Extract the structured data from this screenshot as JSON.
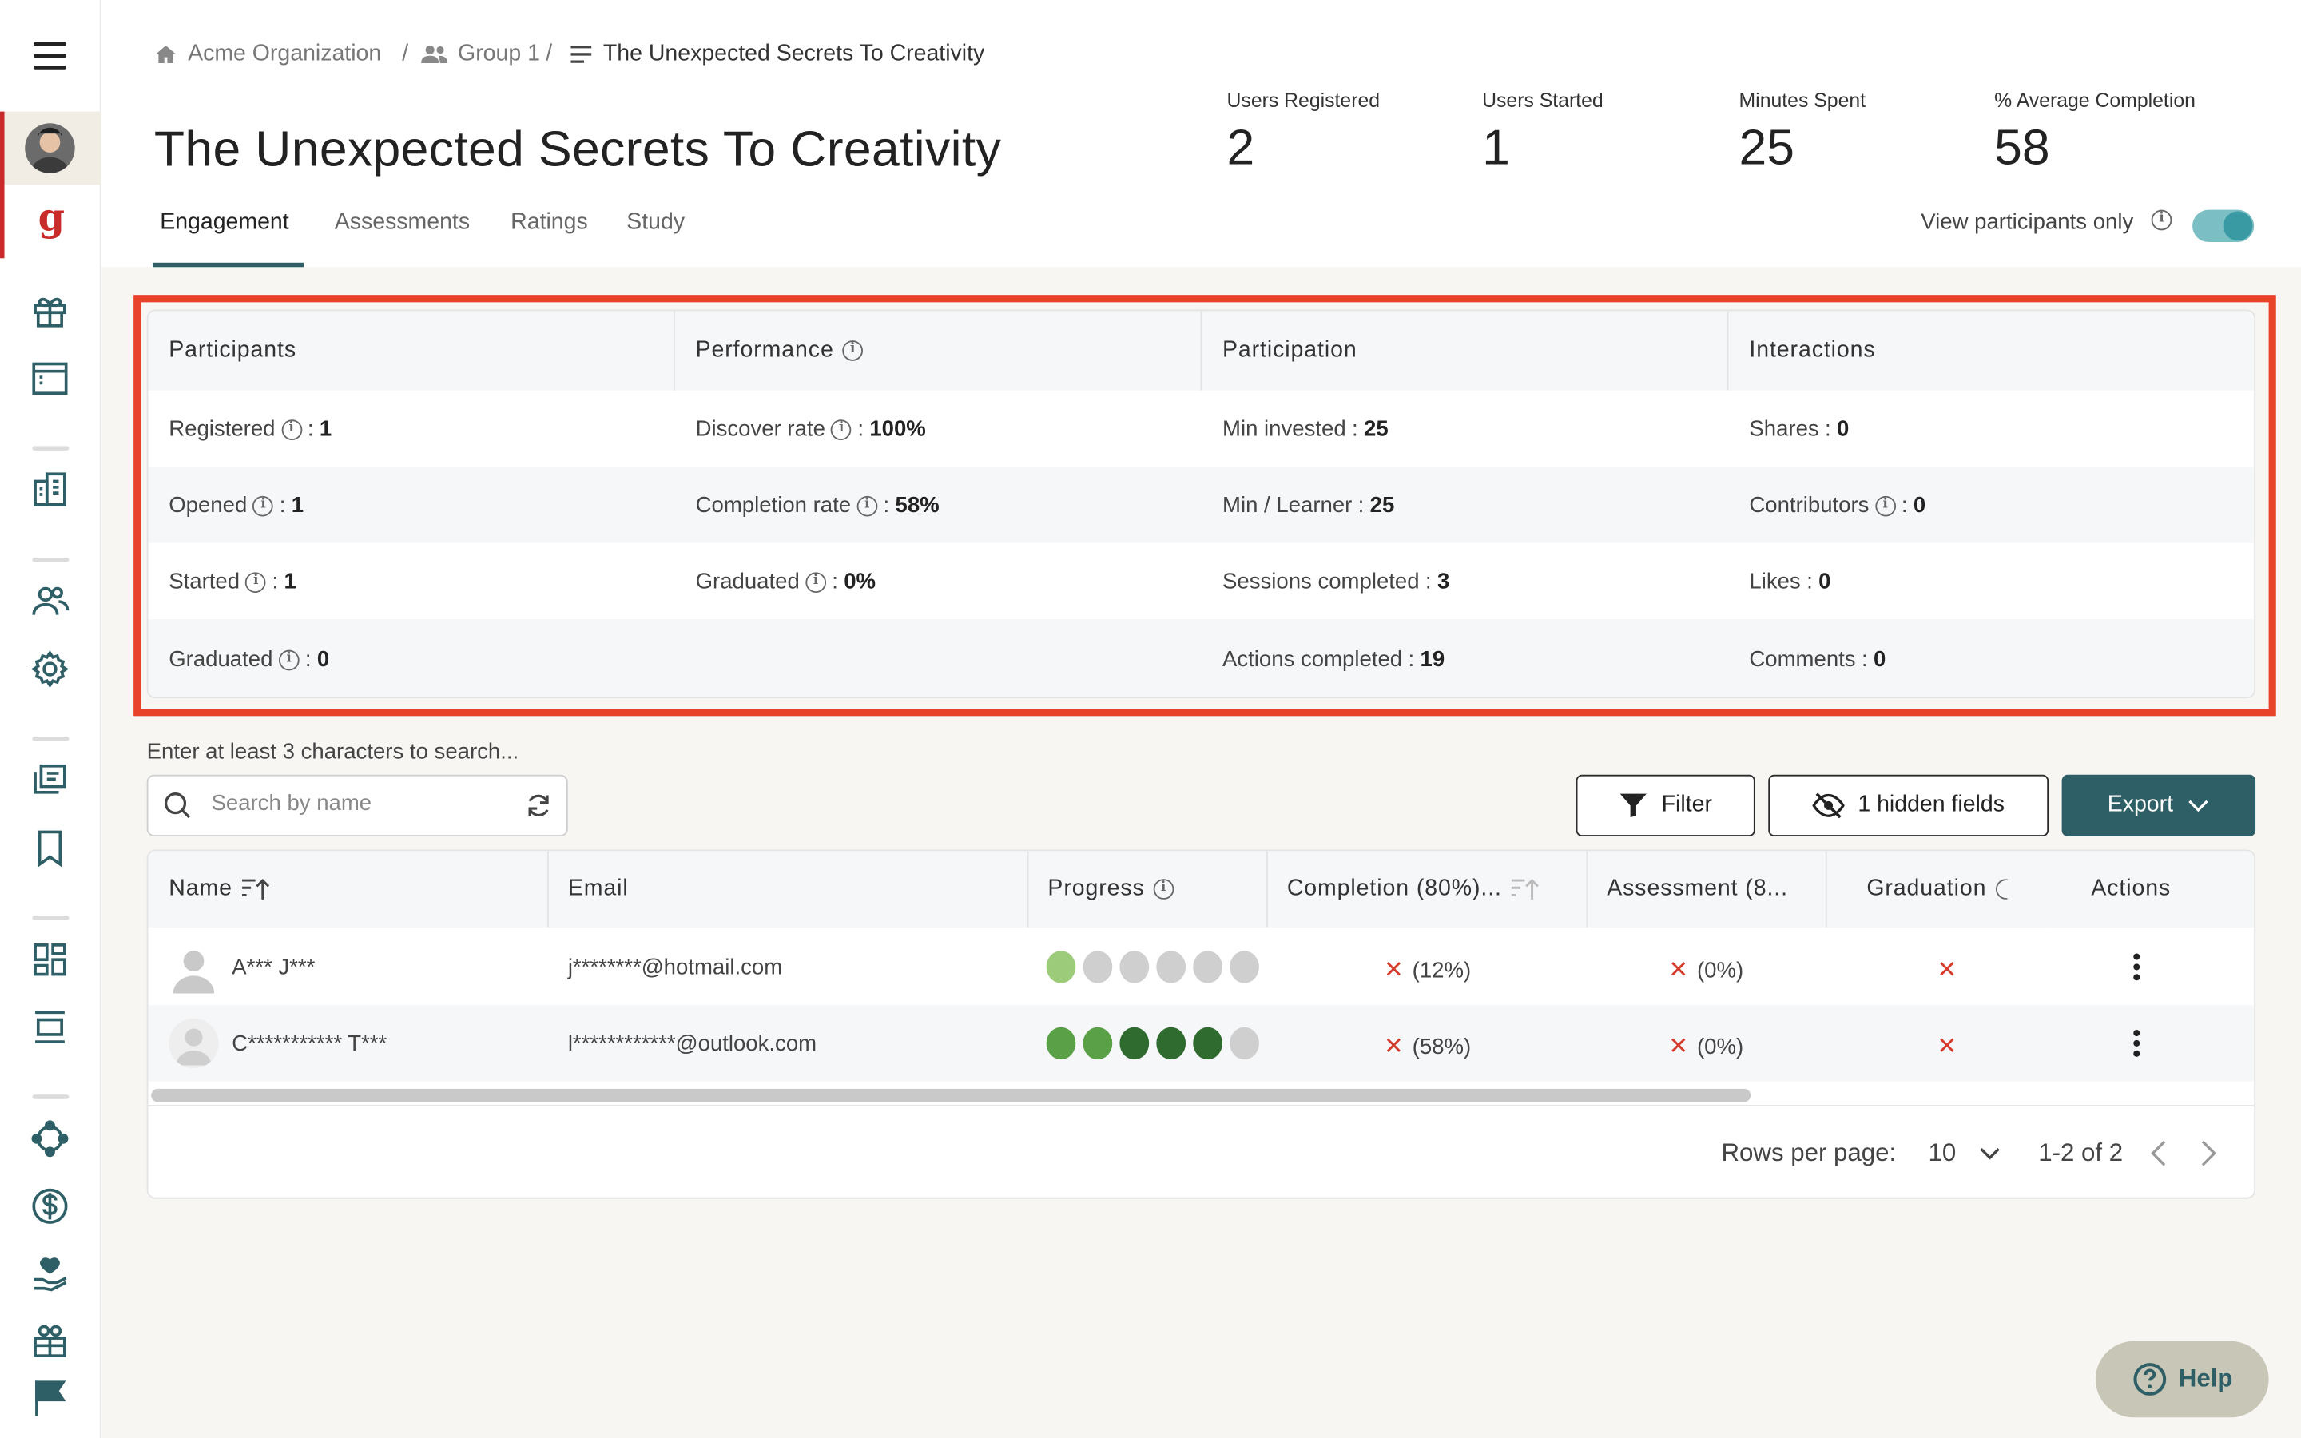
{
  "breadcrumb": {
    "org": "Acme Organization",
    "group": "Group 1",
    "current": "The Unexpected Secrets To Creativity",
    "separator": "/"
  },
  "page": {
    "title": "The Unexpected Secrets To Creativity"
  },
  "stats": [
    {
      "label": "Users Registered",
      "value": "2"
    },
    {
      "label": "Users Started",
      "value": "1"
    },
    {
      "label": "Minutes Spent",
      "value": "25"
    },
    {
      "label": "% Average Completion",
      "value": "58"
    }
  ],
  "tabs": [
    "Engagement",
    "Assessments",
    "Ratings",
    "Study"
  ],
  "active_tab": "Engagement",
  "view_participants": {
    "label": "View participants only",
    "enabled": true
  },
  "summary": {
    "headers": [
      "Participants",
      "Performance",
      "Participation",
      "Interactions"
    ],
    "participants": [
      {
        "label": "Registered",
        "value": "1"
      },
      {
        "label": "Opened",
        "value": "1"
      },
      {
        "label": "Started",
        "value": "1"
      },
      {
        "label": "Graduated",
        "value": "0"
      }
    ],
    "performance": [
      {
        "label": "Discover rate",
        "value": "100%"
      },
      {
        "label": "Completion rate",
        "value": "58%"
      },
      {
        "label": "Graduated",
        "value": "0%"
      }
    ],
    "participation": [
      {
        "label": "Min invested",
        "value": "25"
      },
      {
        "label": "Min / Learner",
        "value": "25"
      },
      {
        "label": "Sessions completed",
        "value": "3"
      },
      {
        "label": "Actions completed",
        "value": "19"
      }
    ],
    "interactions": [
      {
        "label": "Shares",
        "value": "0"
      },
      {
        "label": "Contributors",
        "value": "0"
      },
      {
        "label": "Likes",
        "value": "0"
      },
      {
        "label": "Comments",
        "value": "0"
      }
    ]
  },
  "search": {
    "hint": "Enter at least 3 characters to search...",
    "placeholder": "Search by name"
  },
  "toolbar": {
    "filter_label": "Filter",
    "hidden_fields_label": "1 hidden fields",
    "export_label": "Export"
  },
  "table": {
    "columns": [
      "Name",
      "Email",
      "Progress",
      "Completion (80%)...",
      "Assessment (8...",
      "Graduation",
      "Actions"
    ],
    "rows": [
      {
        "name": "A*** J***",
        "email": "j********@hotmail.com",
        "progress_dots": [
          "#9ccc7a",
          "#cfcfcf",
          "#cfcfcf",
          "#cfcfcf",
          "#cfcfcf",
          "#cfcfcf"
        ],
        "completion": "(12%)",
        "assessment": "(0%)"
      },
      {
        "name": "C*********** T***",
        "email": "l************@outlook.com",
        "progress_dots": [
          "#5aa046",
          "#5aa046",
          "#2f6b2e",
          "#2f6b2e",
          "#2f6b2e",
          "#cfcfcf"
        ],
        "completion": "(58%)",
        "assessment": "(0%)"
      }
    ]
  },
  "pagination": {
    "rows_per_page_label": "Rows per page:",
    "rows_per_page": "10",
    "range": "1-2 of 2"
  },
  "help": {
    "label": "Help"
  },
  "colors": {
    "accent": "#2f5f66",
    "highlight": "#e8432a",
    "error": "#d63a2a"
  }
}
